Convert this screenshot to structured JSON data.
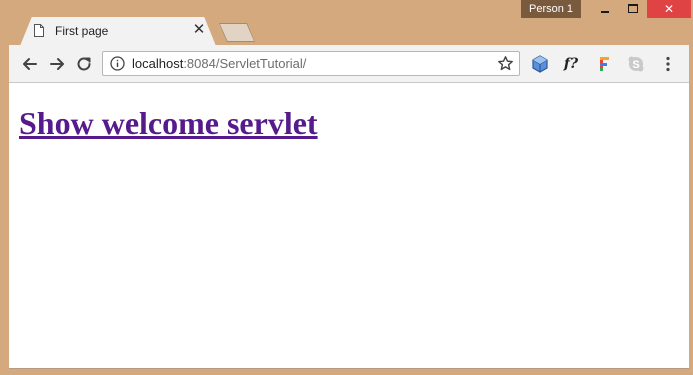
{
  "window": {
    "profile_name": "Person 1",
    "close_glyph": "✕"
  },
  "tabs": [
    {
      "title": "First page",
      "close_glyph": "✕",
      "active": true
    }
  ],
  "toolbar": {
    "url_host": "localhost",
    "url_path": ":8084/ServletTutorial/",
    "icons": [
      "back-arrow-icon",
      "forward-arrow-icon",
      "reload-icon",
      "info-icon",
      "bookmark-star-icon",
      "cube-extension-icon",
      "fx-extension-icon",
      "f-extension-icon",
      "skype-extension-icon",
      "menu-dots-icon"
    ],
    "fx_label": "f?"
  },
  "page": {
    "link_text": "Show welcome servlet",
    "link_color": "#551a8b"
  },
  "colors": {
    "frame": "#d4a97d",
    "close_button": "#e04343",
    "toolbar": "#f2f2f2"
  }
}
